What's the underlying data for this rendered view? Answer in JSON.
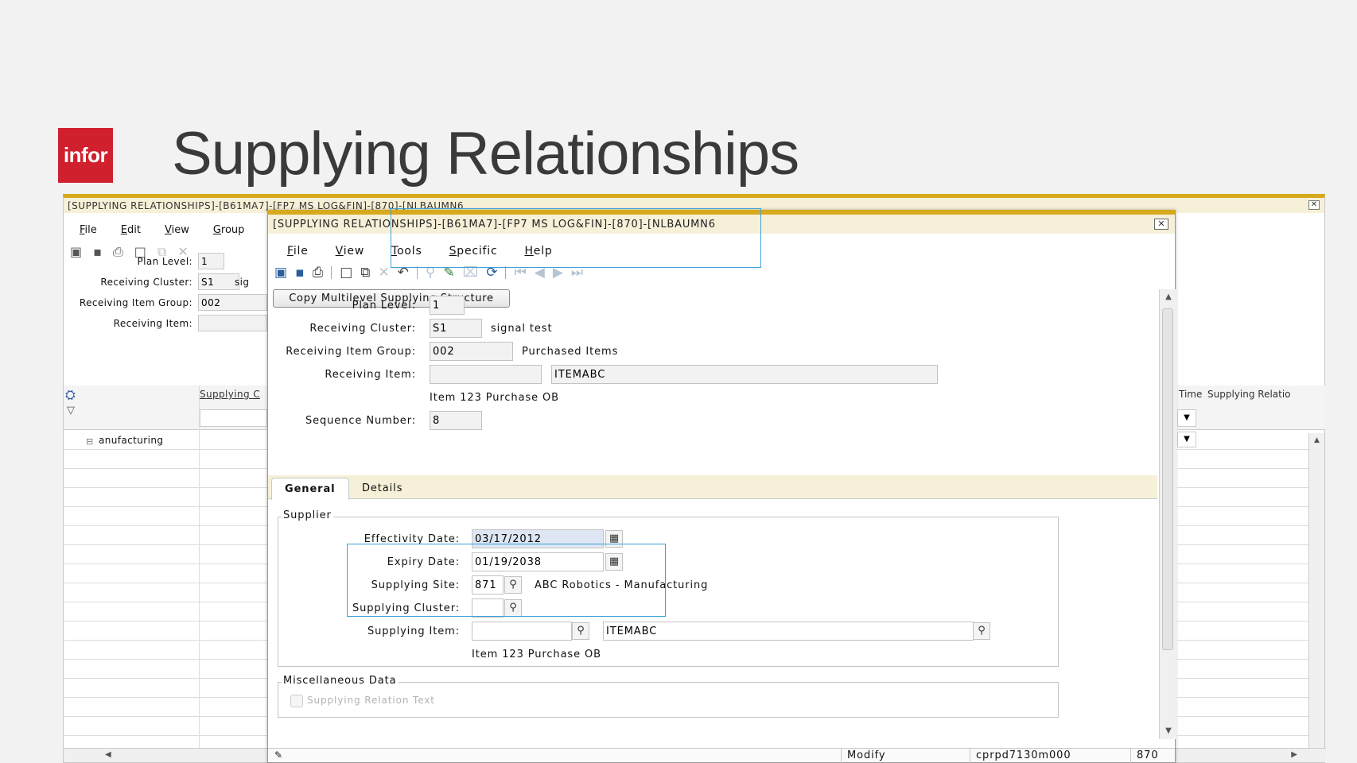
{
  "slide": {
    "logo_text": "infor",
    "title": "Supplying Relationships"
  },
  "bg_window": {
    "title": "[SUPPLYING RELATIONSHIPS]-[B61MA7]-[FP7 MS LOG&FIN]-[870]-[NLBAUMN6",
    "menu": [
      "File",
      "Edit",
      "View",
      "Group"
    ],
    "plan_level_label": "Plan Level:",
    "plan_level": "1",
    "receiving_cluster_label": "Receiving Cluster:",
    "receiving_cluster": "S1",
    "receiving_cluster_desc": "sig",
    "receiving_item_group_label": "Receiving Item Group:",
    "receiving_item_group": "002",
    "receiving_item_label": "Receiving Item:",
    "receiving_item": "",
    "col_supplying": "Supplying C",
    "row_text": "anufacturing",
    "col_time": "Time",
    "col_supplying_relation": "Supplying Relatio"
  },
  "dialog": {
    "title": "[SUPPLYING RELATIONSHIPS]-[B61MA7]-[FP7 MS LOG&FIN]-[870]-[NLBAUMN6",
    "menu": [
      "File",
      "View",
      "Tools",
      "Specific",
      "Help"
    ],
    "copy_button": "Copy Multilevel Supplying Structure",
    "plan_level_label": "Plan Level:",
    "plan_level": "1",
    "receiving_cluster_label": "Receiving Cluster:",
    "receiving_cluster": "S1",
    "receiving_cluster_desc": "signal test",
    "receiving_item_group_label": "Receiving Item Group:",
    "receiving_item_group": "002",
    "receiving_item_group_desc": "Purchased Items",
    "receiving_item_label": "Receiving Item:",
    "receiving_item_project": "",
    "receiving_item": "ITEMABC",
    "receiving_item_desc": "Item 123 Purchase OB",
    "sequence_number_label": "Sequence Number:",
    "sequence_number": "8",
    "tabs": [
      "General",
      "Details"
    ],
    "supplier_group": "Supplier",
    "effectivity_date_label": "Effectivity Date:",
    "effectivity_date": "03/17/2012",
    "expiry_date_label": "Expiry Date:",
    "expiry_date": "01/19/2038",
    "supplying_site_label": "Supplying Site:",
    "supplying_site": "871",
    "supplying_site_desc": "ABC Robotics - Manufacturing",
    "supplying_cluster_label": "Supplying Cluster:",
    "supplying_cluster": "",
    "supplying_item_label": "Supplying Item:",
    "supplying_item_project": "",
    "supplying_item": "ITEMABC",
    "supplying_item_desc": "Item 123 Purchase OB",
    "misc_group": "Miscellaneous Data",
    "supplying_relation_text": "Supplying Relation Text",
    "status_mode": "Modify",
    "status_session": "cprpd7130m000",
    "status_company": "870"
  }
}
